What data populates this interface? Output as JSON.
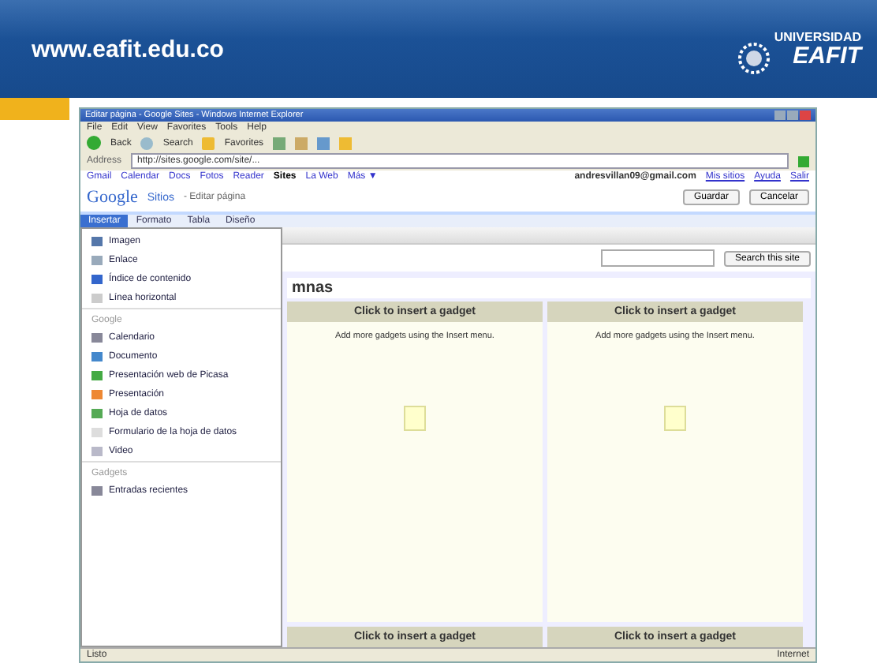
{
  "slide": {
    "url": "www.eafit.edu.co",
    "logo_top": "UNIVERSIDAD",
    "logo_name": "EAFIT"
  },
  "browser": {
    "title": "Editar página - Google Sites - Windows Internet Explorer",
    "menu": [
      "File",
      "Edit",
      "View",
      "Favorites",
      "Tools",
      "Help"
    ],
    "toolbar": [
      "Back",
      "Search",
      "Favorites"
    ],
    "address_label": "Address",
    "address": "http://sites.google.com/site/..."
  },
  "google_bar": {
    "links": [
      {
        "label": "Gmail",
        "selected": false
      },
      {
        "label": "Calendar",
        "selected": false
      },
      {
        "label": "Docs",
        "selected": false
      },
      {
        "label": "Fotos",
        "selected": false
      },
      {
        "label": "Reader",
        "selected": false
      },
      {
        "label": "Sites",
        "selected": true
      },
      {
        "label": "La Web",
        "selected": false
      },
      {
        "label": "Más ▼",
        "selected": false
      }
    ],
    "email": "andresvillan09@gmail.com",
    "account_links": [
      "Mis sitios",
      "Ayuda",
      "Salir"
    ]
  },
  "sites_header": {
    "logo": "Google",
    "product": "Sitios",
    "subtitle": "- Editar página",
    "buttons": [
      "Guardar",
      "Cancelar"
    ]
  },
  "editor_tabs": [
    {
      "label": "Insertar",
      "selected": true
    },
    {
      "label": "Formato",
      "selected": false
    },
    {
      "label": "Tabla",
      "selected": false
    },
    {
      "label": "Diseño",
      "selected": false
    }
  ],
  "insert_menu": [
    {
      "items": [
        "Imagen",
        "Enlace",
        "Índice de contenido",
        "Línea horizontal"
      ]
    },
    {
      "heading": "Google",
      "items": [
        "Calendario",
        "Documento",
        "Presentación web de Picasa",
        "Presentación",
        "Hoja de datos",
        "Formulario de la hoja de datos",
        "Video"
      ]
    },
    {
      "heading": "Gadgets",
      "items": [
        "Entradas recientes"
      ]
    }
  ],
  "search_button": "Search this site",
  "page_title": "mnas",
  "gadgets": [
    {
      "title": "Click to insert a gadget",
      "hint": "Add more gadgets using the Insert menu."
    },
    {
      "title": "Click to insert a gadget",
      "hint": "Add more gadgets using the Insert menu."
    },
    {
      "title": "Click to insert a gadget"
    },
    {
      "title": "Click to insert a gadget"
    }
  ],
  "status_bar": {
    "left": "Listo",
    "right": "Internet"
  }
}
